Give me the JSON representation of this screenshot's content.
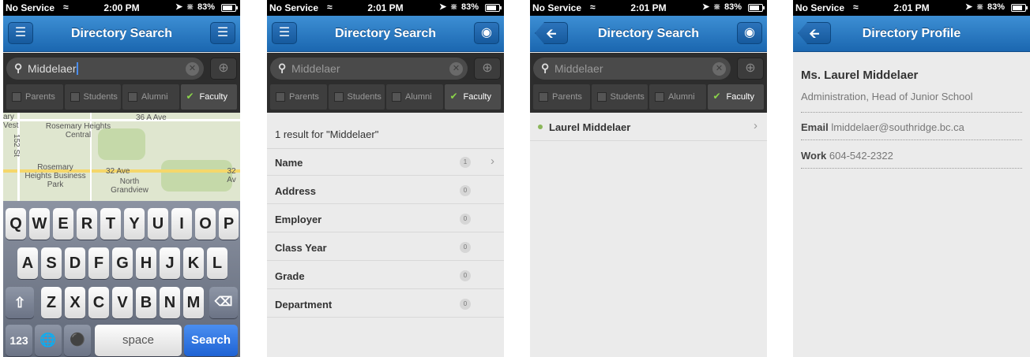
{
  "status_bar": {
    "carrier": "No Service",
    "battery_label": "83%",
    "battery_level": 0.83,
    "time_1": "2:00 PM",
    "time_2": "2:01 PM",
    "time_3": "2:01 PM",
    "time_4": "2:01 PM"
  },
  "nav": {
    "search_title": "Directory Search",
    "profile_title": "Directory Profile"
  },
  "search": {
    "query": "Middelaer",
    "filters": [
      "Parents",
      "Students",
      "Alumni",
      "Faculty"
    ],
    "active_filter": "Faculty"
  },
  "map": {
    "labels": [
      "36 A Ave",
      "Rosemary Heights Central",
      "152 St",
      "Rosemary Heights Business Park",
      "32 Ave",
      "32 Av",
      "North Grandview",
      "ary",
      "Vest"
    ]
  },
  "keyboard": {
    "row1": [
      "Q",
      "W",
      "E",
      "R",
      "T",
      "Y",
      "U",
      "I",
      "O",
      "P"
    ],
    "row2": [
      "A",
      "S",
      "D",
      "F",
      "G",
      "H",
      "J",
      "K",
      "L"
    ],
    "row3": [
      "Z",
      "X",
      "C",
      "V",
      "B",
      "N",
      "M"
    ],
    "numbers_key": "123",
    "space_key": "space",
    "search_key": "Search"
  },
  "results": {
    "count_text": "1 result for \"Middelaer\"",
    "categories": [
      {
        "label": "Name",
        "count": "1"
      },
      {
        "label": "Address",
        "count": "0"
      },
      {
        "label": "Employer",
        "count": "0"
      },
      {
        "label": "Class Year",
        "count": "0"
      },
      {
        "label": "Grade",
        "count": "0"
      },
      {
        "label": "Department",
        "count": "0"
      }
    ],
    "person": "Laurel Middelaer"
  },
  "profile": {
    "name": "Ms. Laurel Middelaer",
    "title": "Administration, Head of Junior School",
    "email_label": "Email",
    "email": "lmiddelaer@southridge.bc.ca",
    "work_label": "Work",
    "work": "604-542-2322"
  },
  "colors": {
    "nav_blue": "#1b67b0",
    "search_key_blue": "#1f63d4",
    "check_green": "#8bd44a"
  },
  "icons": [
    "wifi-icon",
    "location-icon",
    "bluetooth-icon",
    "battery-icon",
    "menu-icon",
    "list-icon",
    "map-pin-icon",
    "back-arrow-icon",
    "search-icon",
    "clear-icon",
    "locate-icon",
    "checkbox-icon",
    "checkmark-icon",
    "chevron-right-icon",
    "shift-icon",
    "backspace-icon",
    "globe-icon",
    "microphone-icon"
  ]
}
